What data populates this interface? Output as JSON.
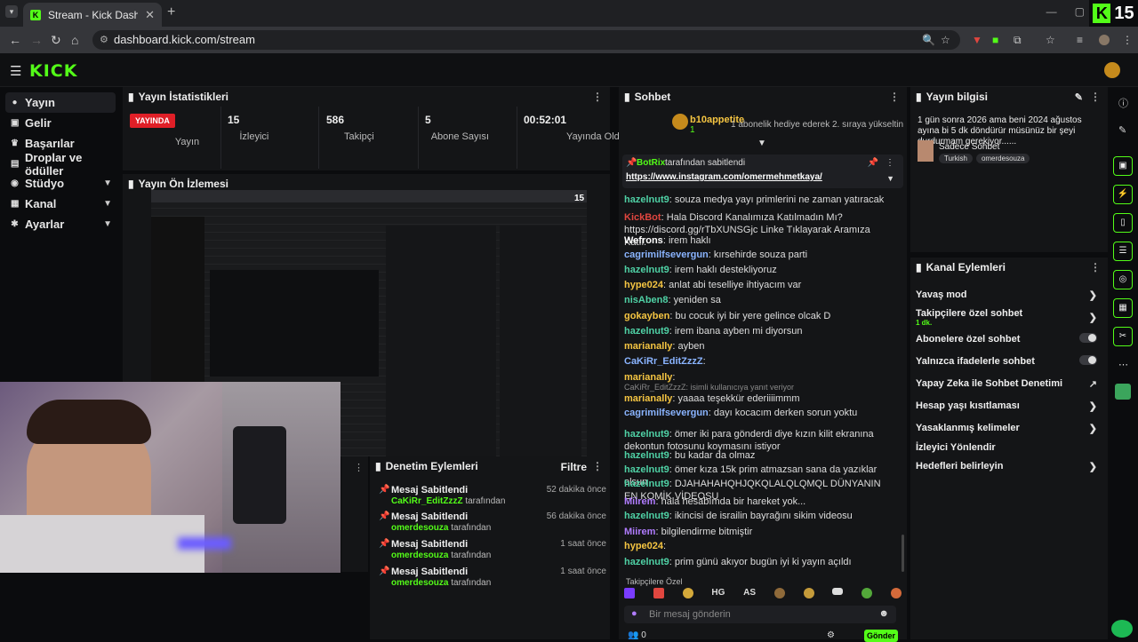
{
  "browser": {
    "tab_title": "Stream - Kick Dashboard",
    "url": "dashboard.kick.com/stream",
    "count_badge": "15"
  },
  "header": {
    "logo": "KICK"
  },
  "sidebar": {
    "items": [
      {
        "label": "Yayın",
        "icon": "broadcast-icon",
        "active": true
      },
      {
        "label": "Gelir",
        "icon": "money-icon"
      },
      {
        "label": "Başarılar",
        "icon": "trophy-icon"
      },
      {
        "label": "Droplar ve ödüller",
        "icon": "gift-icon"
      },
      {
        "label": "Stüdyo",
        "icon": "studio-icon",
        "expand": true
      },
      {
        "label": "Kanal",
        "icon": "channel-icon",
        "expand": true
      },
      {
        "label": "Ayarlar",
        "icon": "gear-icon",
        "expand": true
      }
    ]
  },
  "stats": {
    "title": "Yayın İstatistikleri",
    "live_label": "YAYINDA",
    "stream_label": "Yayın",
    "viewers_value": "15",
    "viewers_label": "İzleyici",
    "followers_value": "586",
    "followers_label": "Takipçi",
    "subs_value": "5",
    "subs_label": "Abone Sayısı",
    "duration_value": "00:52:01",
    "duration_label": "Yayında Olduğu Süre"
  },
  "preview": {
    "title": "Yayın Ön İzlemesi"
  },
  "moderation": {
    "title": "Denetim Eylemleri",
    "filter_label": "Filtre",
    "items": [
      {
        "action": "Mesaj Sabitlendi",
        "user": "CaKiRr_EditZzzZ",
        "suffix": "tarafından",
        "time": "52 dakika önce"
      },
      {
        "action": "Mesaj Sabitlendi",
        "user": "omerdesouza",
        "suffix": "tarafından",
        "time": "56 dakika önce"
      },
      {
        "action": "Mesaj Sabitlendi",
        "user": "omerdesouza",
        "suffix": "tarafından",
        "time": "1 saat önce"
      },
      {
        "action": "Mesaj Sabitlendi",
        "user": "omerdesouza",
        "suffix": "tarafından",
        "time": "1 saat önce"
      }
    ]
  },
  "chat": {
    "title": "Sohbet",
    "top_gifter": "b10appetite",
    "top_gifter_count": "1",
    "gift_text": "1 abonelik hediye ederek 2. sıraya yükseltin",
    "pinned_by": "BotRix",
    "pinned_suffix": "tarafından sabitlendi",
    "pinned_link": "https://www.instagram.com/omermehmetkaya/",
    "messages": [
      {
        "user": "hazelnut9",
        "color": "#4fd1a5",
        "text": "souza medya yayı primlerini ne zaman yatıracak"
      },
      {
        "user": "KickBot",
        "color": "#e0463f",
        "text": "Hala Discord Kanalımıza Katılmadın Mı? https://discord.gg/rTbXUNSGjc Linke Tıklayarak Aramıza Katıl."
      },
      {
        "user": "Wefrons",
        "color": "#ffffff",
        "text": "irem haklı"
      },
      {
        "user": "cagrimilfsevergun",
        "color": "#8ab4ff",
        "text": "kırsehirde souza parti"
      },
      {
        "user": "hazelnut9",
        "color": "#4fd1a5",
        "text": "irem haklı destekliyoruz"
      },
      {
        "user": "hype024",
        "color": "#f5c542",
        "text": "anlat abi teselliye ihtiyacım var"
      },
      {
        "user": "nisAben8",
        "color": "#4fd1a5",
        "text": "yeniden sa"
      },
      {
        "user": "gokayben",
        "color": "#f5c542",
        "text": "bu cocuk iyi bir yere gelince olcak D"
      },
      {
        "user": "hazelnut9",
        "color": "#4fd1a5",
        "text": "irem ibana ayben mi diyorsun"
      },
      {
        "user": "marianally",
        "color": "#f5c542",
        "text": "ayben"
      },
      {
        "user": "CaKiRr_EditZzzZ",
        "color": "#8ab4ff",
        "text": ""
      },
      {
        "user": "marianally",
        "color": "#f5c542",
        "text": ""
      },
      {
        "user": "marianally",
        "color": "#f5c542",
        "text": "yaaaa teşekkür ederiiiimmm"
      },
      {
        "user": "cagrimilfsevergun",
        "color": "#8ab4ff",
        "text": "dayı kocacım derken sorun yoktu"
      },
      {
        "user": "hazelnut9",
        "color": "#4fd1a5",
        "text": "ömer iki para gönderdi diye kızın kilit ekranına dekontun fotosunu koymasını istiyor"
      },
      {
        "user": "hazelnut9",
        "color": "#4fd1a5",
        "text": "bu kadar da olmaz"
      },
      {
        "user": "hazelnut9",
        "color": "#4fd1a5",
        "text": "ömer kıza 15k prim atmazsan sana da yazıklar olsun"
      },
      {
        "user": "hazelnut9",
        "color": "#4fd1a5",
        "text": "DJAHAHAHQHJQKQLALQLQMQL DÜNYANIN EN KOMİK VİDEOSU"
      },
      {
        "user": "Miirem",
        "color": "#b07cff",
        "text": "hala hesabımda bir hareket yok..."
      },
      {
        "user": "hazelnut9",
        "color": "#4fd1a5",
        "text": "ikincisi de israilin bayrağını sikim videosu"
      },
      {
        "user": "Miirem",
        "color": "#b07cff",
        "text": "bilgilendirme bitmiştir"
      },
      {
        "user": "hype024",
        "color": "#f5c542",
        "text": ""
      },
      {
        "user": "hazelnut9",
        "color": "#4fd1a5",
        "text": "prim günü akıyor bugün iyi ki yayın açıldı"
      }
    ],
    "system_line": "CaKiRr_EditZzzZ: isimli kullanıcıya yanıt veriyor",
    "followers_only": "Takipçilere Özel",
    "input_placeholder": "Bir mesaj gönderin",
    "send_label": "Gönder"
  },
  "info": {
    "title": "Yayın bilgisi",
    "stream_title": "1 gün sonra 2026 ama beni 2024 ağustos ayına bi 5 dk döndürür müsünüz bir şeyi durdurmam gerekiyor......",
    "category": "Sadece Sohbet",
    "tags": [
      "Turkish",
      "omerdesouza"
    ]
  },
  "actions": {
    "title": "Kanal Eylemleri",
    "items": [
      {
        "label": "Yavaş mod",
        "kind": "arrow"
      },
      {
        "label": "Takipçilere özel sohbet",
        "sub": "1 dk.",
        "kind": "arrow"
      },
      {
        "label": "Abonelere özel sohbet",
        "kind": "toggle"
      },
      {
        "label": "Yalnızca ifadelerle sohbet",
        "kind": "toggle"
      },
      {
        "label": "Yapay Zeka ile Sohbet Denetimi",
        "kind": "external"
      },
      {
        "label": "Hesap yaşı kısıtlaması",
        "kind": "arrow"
      },
      {
        "label": "Yasaklanmış kelimeler",
        "kind": "arrow"
      },
      {
        "label": "İzleyici Yönlendir",
        "kind": "none"
      },
      {
        "label": "Hedefleri belirleyin",
        "kind": "arrow"
      }
    ]
  },
  "colors": {
    "accent": "#53fc18",
    "live": "#e01f27",
    "bg": "#0b0c0e",
    "panel": "#141517"
  }
}
